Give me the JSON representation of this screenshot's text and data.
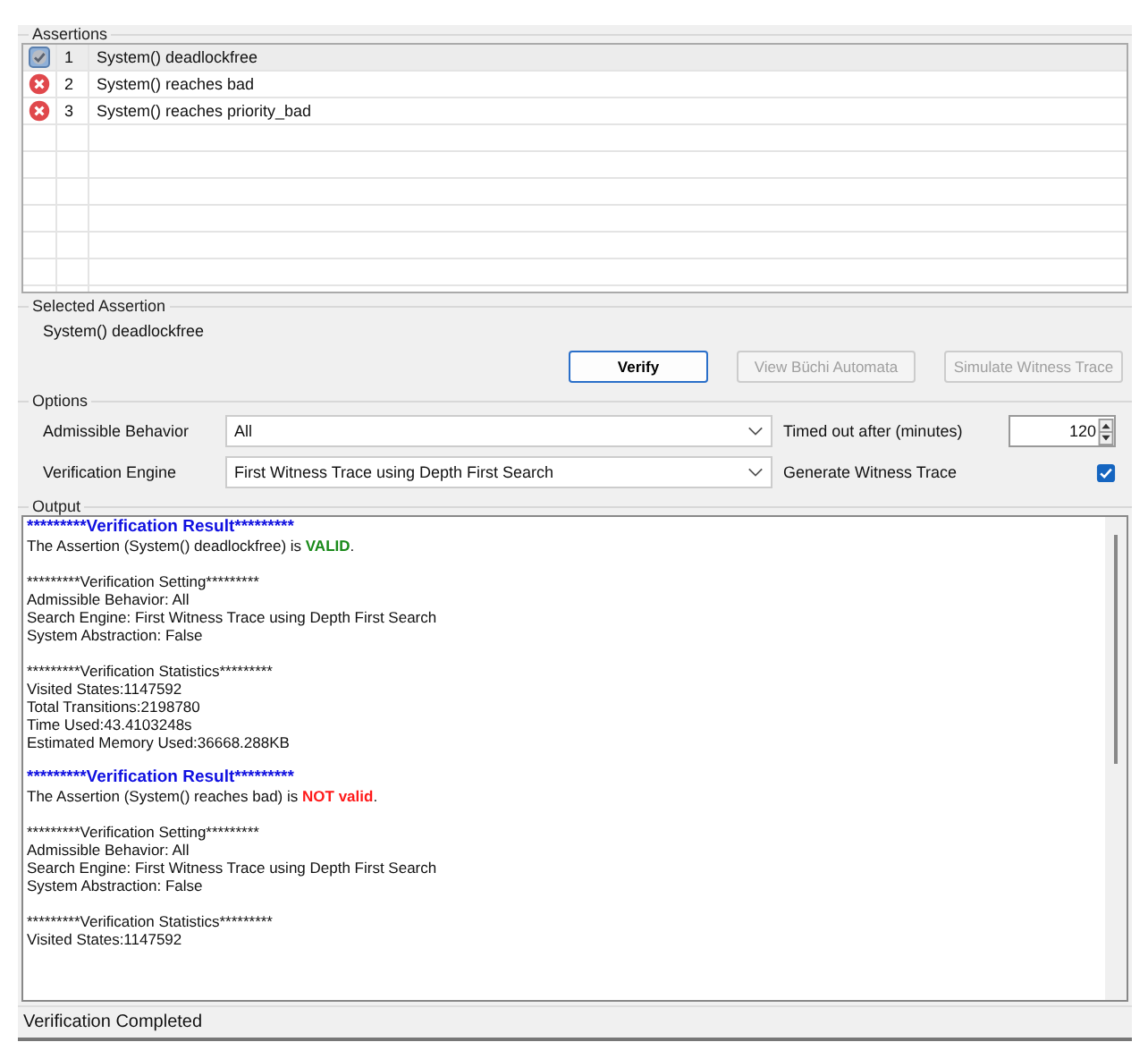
{
  "assertions": {
    "title": "Assertions",
    "rows": [
      {
        "valid": true,
        "number": "1",
        "text": "System() deadlockfree",
        "selected": true
      },
      {
        "valid": false,
        "number": "2",
        "text": "System() reaches bad",
        "selected": false
      },
      {
        "valid": false,
        "number": "3",
        "text": "System() reaches priority_bad",
        "selected": false
      }
    ]
  },
  "selected_assertion": {
    "title": "Selected Assertion",
    "text": "System() deadlockfree",
    "buttons": [
      {
        "label": "Verify",
        "disabled": false
      },
      {
        "label": "View Büchi Automata",
        "disabled": true
      },
      {
        "label": "Simulate Witness Trace",
        "disabled": true
      }
    ]
  },
  "options": {
    "title": "Options",
    "admissible_behavior": {
      "label": "Admissible Behavior",
      "value": "All"
    },
    "verification_engine": {
      "label": "Verification Engine",
      "value": "First Witness Trace using Depth First Search"
    },
    "timeout": {
      "label": "Timed out after (minutes)",
      "value": "120"
    },
    "generate_witness_trace": {
      "label": "Generate Witness Trace",
      "checked": true
    }
  },
  "output": {
    "title": "Output",
    "lines": [
      {
        "kind": "heading",
        "text": "*********Verification Result*********"
      },
      {
        "kind": "result",
        "text": "The Assertion (System() deadlockfree) is ",
        "verdict": "VALID",
        "valid": true,
        "end": "."
      },
      {
        "kind": "blank"
      },
      {
        "kind": "text",
        "text": "*********Verification Setting*********"
      },
      {
        "kind": "text",
        "text": "Admissible Behavior: All"
      },
      {
        "kind": "text",
        "text": "Search Engine: First Witness Trace using Depth First Search"
      },
      {
        "kind": "text",
        "text": "System Abstraction: False"
      },
      {
        "kind": "blank"
      },
      {
        "kind": "text",
        "text": "*********Verification Statistics*********"
      },
      {
        "kind": "text",
        "text": "Visited States:1147592"
      },
      {
        "kind": "text",
        "text": "Total Transitions:2198780"
      },
      {
        "kind": "text",
        "text": "Time Used:43.4103248s"
      },
      {
        "kind": "text",
        "text": "Estimated Memory Used:36668.288KB"
      },
      {
        "kind": "blank"
      },
      {
        "kind": "heading",
        "text": "*********Verification Result*********"
      },
      {
        "kind": "result",
        "text": "The Assertion (System() reaches bad) is ",
        "verdict": "NOT valid",
        "valid": false,
        "end": "."
      },
      {
        "kind": "blank"
      },
      {
        "kind": "text",
        "text": "*********Verification Setting*********"
      },
      {
        "kind": "text",
        "text": "Admissible Behavior: All"
      },
      {
        "kind": "text",
        "text": "Search Engine: First Witness Trace using Depth First Search"
      },
      {
        "kind": "text",
        "text": "System Abstraction: False"
      },
      {
        "kind": "blank"
      },
      {
        "kind": "text",
        "text": "*********Verification Statistics*********"
      },
      {
        "kind": "text",
        "text": "Visited States:1147592"
      }
    ]
  },
  "status_bar": "Verification Completed"
}
